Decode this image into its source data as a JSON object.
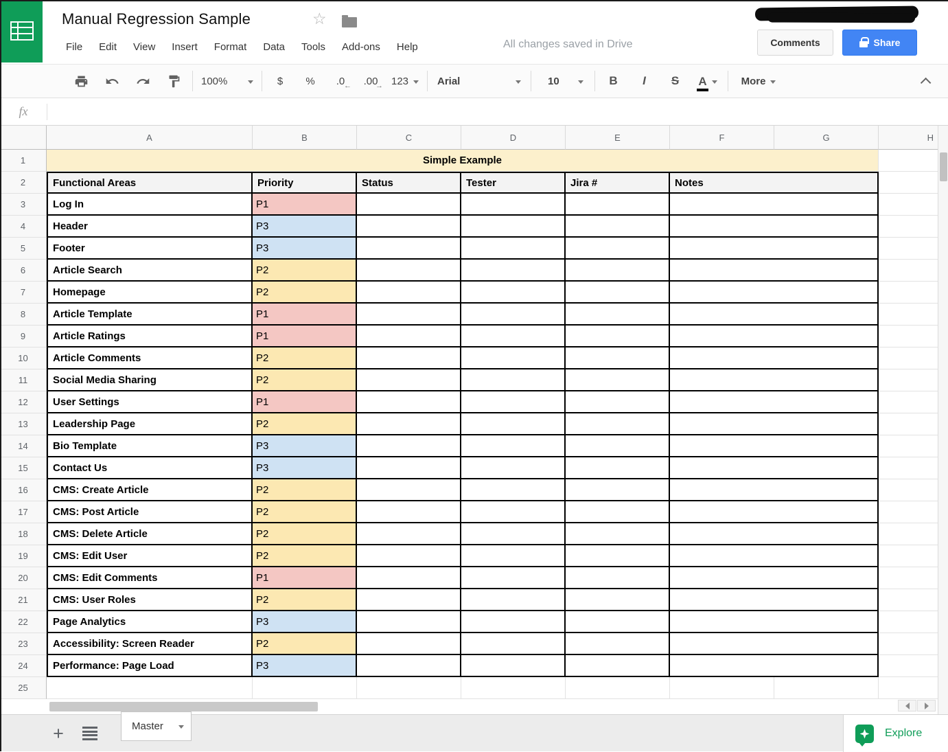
{
  "header": {
    "doc_title": "Manual Regression Sample",
    "menu_items": [
      "File",
      "Edit",
      "View",
      "Insert",
      "Format",
      "Data",
      "Tools",
      "Add-ons",
      "Help"
    ],
    "save_status": "All changes saved in Drive",
    "comments_label": "Comments",
    "share_label": "Share"
  },
  "toolbar": {
    "zoom": "100%",
    "currency": "$",
    "percent": "%",
    "decimal_decrease": ".0",
    "decimal_increase": ".00",
    "number_format": "123",
    "font_family": "Arial",
    "font_size": "10",
    "bold": "B",
    "italic": "I",
    "strikethrough": "S",
    "text_color": "A",
    "more": "More"
  },
  "formula_bar": {
    "fx_label": "fx",
    "value": ""
  },
  "grid": {
    "column_letters": [
      "A",
      "B",
      "C",
      "D",
      "E",
      "F",
      "G",
      "H"
    ],
    "sheet_title": "Simple Example",
    "headers": [
      "Functional Areas",
      "Priority",
      "Status",
      "Tester",
      "Jira #",
      "Notes"
    ],
    "visible_row_count": 25,
    "rows": [
      {
        "row": 3,
        "area": "Log In",
        "priority": "P1"
      },
      {
        "row": 4,
        "area": "Header",
        "priority": "P3"
      },
      {
        "row": 5,
        "area": "Footer",
        "priority": "P3"
      },
      {
        "row": 6,
        "area": "Article Search",
        "priority": "P2"
      },
      {
        "row": 7,
        "area": "Homepage",
        "priority": "P2"
      },
      {
        "row": 8,
        "area": "Article Template",
        "priority": "P1"
      },
      {
        "row": 9,
        "area": "Article Ratings",
        "priority": "P1"
      },
      {
        "row": 10,
        "area": "Article Comments",
        "priority": "P2"
      },
      {
        "row": 11,
        "area": "Social Media Sharing",
        "priority": "P2"
      },
      {
        "row": 12,
        "area": "User Settings",
        "priority": "P1"
      },
      {
        "row": 13,
        "area": "Leadership Page",
        "priority": "P2"
      },
      {
        "row": 14,
        "area": "Bio Template",
        "priority": "P3"
      },
      {
        "row": 15,
        "area": "Contact Us",
        "priority": "P3"
      },
      {
        "row": 16,
        "area": "CMS: Create Article",
        "priority": "P2"
      },
      {
        "row": 17,
        "area": "CMS: Post Article",
        "priority": "P2"
      },
      {
        "row": 18,
        "area": "CMS: Delete Article",
        "priority": "P2"
      },
      {
        "row": 19,
        "area": "CMS: Edit User",
        "priority": "P2"
      },
      {
        "row": 20,
        "area": "CMS: Edit Comments",
        "priority": "P1"
      },
      {
        "row": 21,
        "area": "CMS: User Roles",
        "priority": "P2"
      },
      {
        "row": 22,
        "area": "Page Analytics",
        "priority": "P3"
      },
      {
        "row": 23,
        "area": "Accessibility: Screen Reader",
        "priority": "P2"
      },
      {
        "row": 24,
        "area": "Performance: Page Load",
        "priority": "P3"
      }
    ]
  },
  "sheet_bar": {
    "active_tab": "Master",
    "explore_label": "Explore"
  },
  "colors": {
    "priority_p1": "#F4C7C3",
    "priority_p2": "#FCE8B2",
    "priority_p3": "#CFE2F3",
    "title_row_bg": "#FCF0CC",
    "header_row_bg": "#F3F3F3",
    "brand_green": "#0F9D58",
    "share_blue": "#4285F4",
    "explore_green": "#0F9D58"
  }
}
